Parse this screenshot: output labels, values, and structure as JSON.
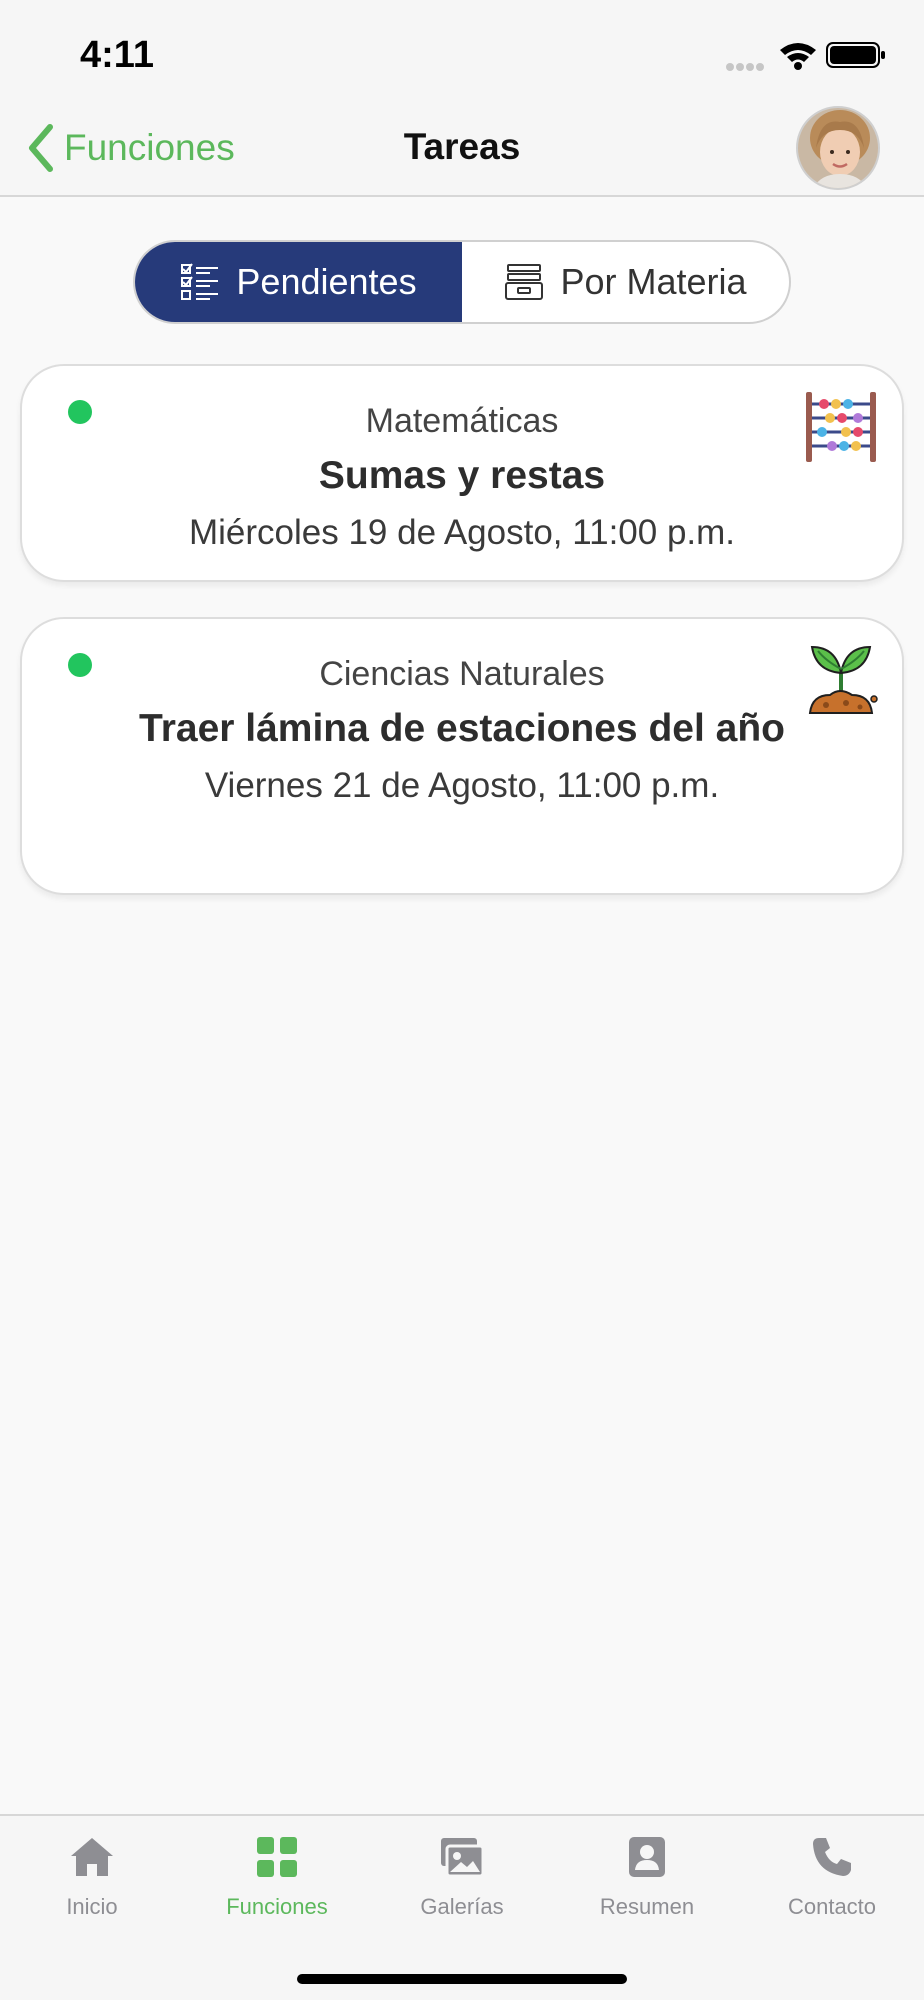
{
  "status_bar": {
    "time": "4:11"
  },
  "nav": {
    "back_label": "Funciones",
    "title": "Tareas"
  },
  "segments": [
    {
      "label": "Pendientes",
      "icon": "checklist-icon",
      "active": true
    },
    {
      "label": "Por Materia",
      "icon": "archive-box-icon",
      "active": false
    }
  ],
  "tasks": [
    {
      "subject": "Matemáticas",
      "title": "Sumas y restas",
      "due": "Miércoles 19 de Agosto, 11:00 p.m.",
      "status_color": "#22c55e",
      "icon": "abacus-icon"
    },
    {
      "subject": "Ciencias Naturales",
      "title": "Traer lámina de estaciones del año",
      "due": "Viernes 21 de Agosto, 11:00 p.m.",
      "status_color": "#22c55e",
      "icon": "seedling-icon"
    }
  ],
  "tab_bar": {
    "items": [
      {
        "label": "Inicio",
        "icon": "home-icon"
      },
      {
        "label": "Funciones",
        "icon": "grid-icon",
        "active": true
      },
      {
        "label": "Galerías",
        "icon": "gallery-icon"
      },
      {
        "label": "Resumen",
        "icon": "profile-card-icon"
      },
      {
        "label": "Contacto",
        "icon": "phone-icon"
      }
    ]
  },
  "colors": {
    "accent_green": "#5cb85c",
    "segment_active": "#263a7a",
    "tab_inactive": "#8e8e93"
  }
}
